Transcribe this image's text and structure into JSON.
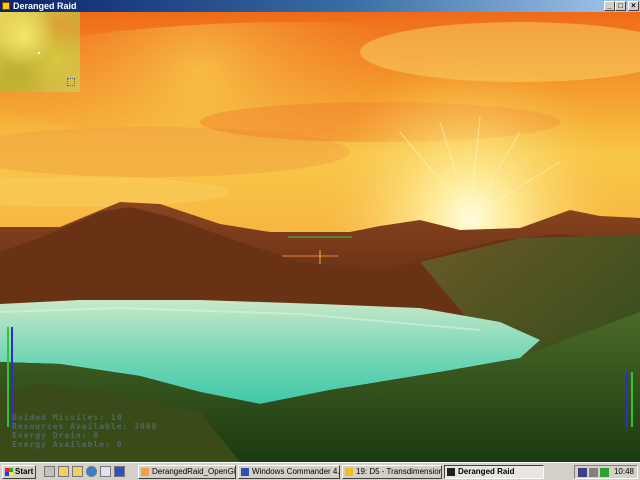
{
  "window": {
    "title": "Deranged Raid"
  },
  "hud": {
    "lines": [
      "Guided Missiles: 10",
      "Resources Available: 3000",
      "Energy Drain: 0",
      "Energy Available: 0"
    ]
  },
  "colors": {
    "sky_top": "#f8a020",
    "sun": "#fff8d0",
    "mountain": "#7a3a18",
    "lake": "#7ad8b8",
    "hill_green": "#3a5a20",
    "gauge_green": "#38c038",
    "gauge_blue": "#3030c0"
  },
  "taskbar": {
    "start_label": "Start",
    "tasks": [
      {
        "label": "DerangedRaid_OpenGL -...",
        "icon": "app-icon"
      },
      {
        "label": "Windows Commander 4.01...",
        "icon": "floppy-icon"
      },
      {
        "label": "19: D5 - Transdimensional ...",
        "icon": "winamp-icon"
      },
      {
        "label": "Deranged Raid",
        "icon": "game-icon"
      }
    ],
    "clock": "10:48"
  }
}
